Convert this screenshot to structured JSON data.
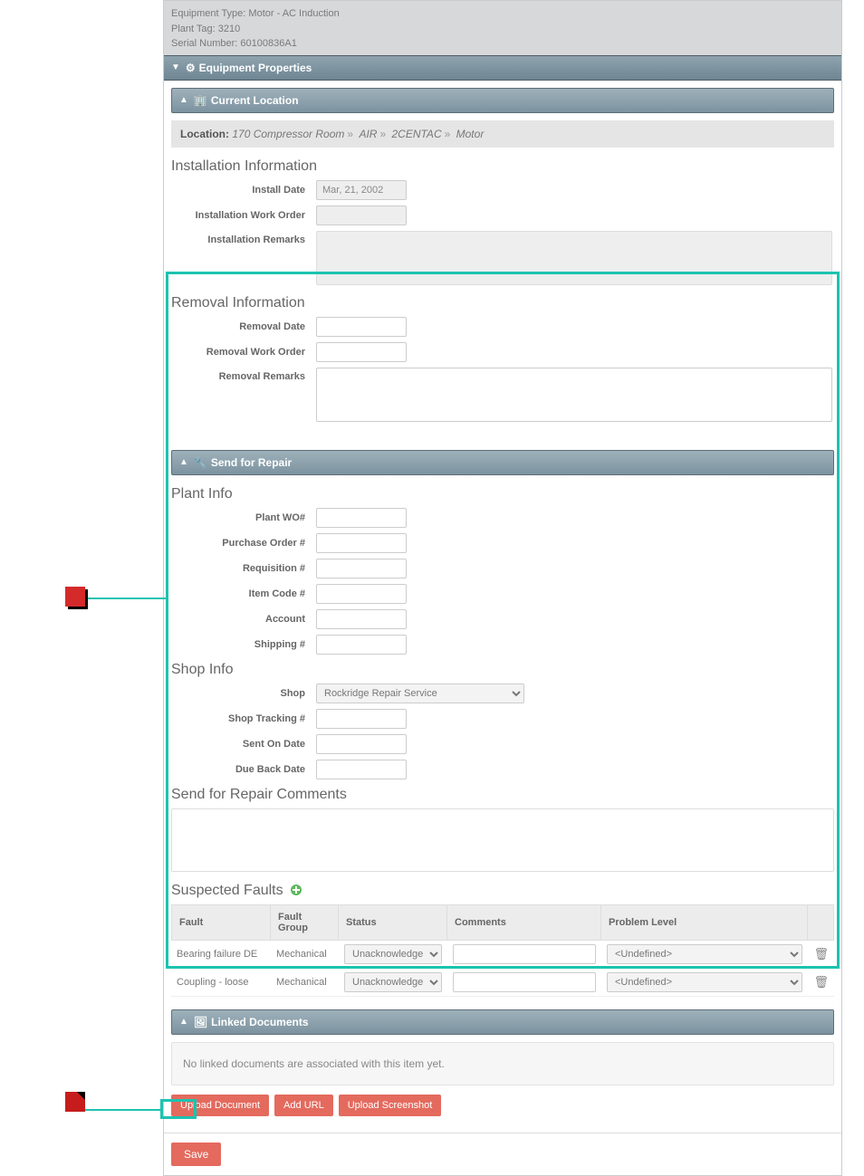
{
  "header": {
    "equip_type_label": "Equipment Type:",
    "equip_type_value": "Motor - AC Induction",
    "plant_tag_label": "Plant Tag:",
    "plant_tag_value": "3210",
    "serial_label": "Serial Number:",
    "serial_value": "60100836A1"
  },
  "panels": {
    "equipment_properties": "Equipment Properties",
    "current_location": "Current Location",
    "send_for_repair": "Send for Repair",
    "linked_documents": "Linked Documents"
  },
  "location": {
    "label": "Location:",
    "crumbs": [
      "170 Compressor Room",
      "AIR",
      "2CENTAC",
      "Motor"
    ]
  },
  "install": {
    "title": "Installation Information",
    "date_label": "Install Date",
    "date_value": "Mar, 21, 2002",
    "wo_label": "Installation Work Order",
    "remarks_label": "Installation Remarks"
  },
  "removal": {
    "title": "Removal Information",
    "date_label": "Removal Date",
    "wo_label": "Removal Work Order",
    "remarks_label": "Removal Remarks"
  },
  "plant_info": {
    "title": "Plant Info",
    "plant_wo": "Plant WO#",
    "po": "Purchase Order #",
    "req": "Requisition #",
    "item": "Item Code #",
    "account": "Account",
    "shipping": "Shipping #"
  },
  "shop_info": {
    "title": "Shop Info",
    "shop": "Shop",
    "shop_value": "Rockridge Repair Service",
    "tracking": "Shop Tracking #",
    "sent": "Sent On Date",
    "due": "Due Back Date"
  },
  "repair_comments": {
    "title": "Send for Repair Comments"
  },
  "faults": {
    "title": "Suspected Faults",
    "headers": {
      "fault": "Fault",
      "group": "Fault Group",
      "status": "Status",
      "comments": "Comments",
      "problem": "Problem Level"
    },
    "rows": [
      {
        "fault": "Bearing failure DE",
        "group": "Mechanical",
        "status": "Unacknowledged",
        "problem": "<Undefined>"
      },
      {
        "fault": "Coupling - loose",
        "group": "Mechanical",
        "status": "Unacknowledged",
        "problem": "<Undefined>"
      }
    ]
  },
  "linked": {
    "empty_msg": "No linked documents are associated with this item yet.",
    "upload_doc": "Upload Document",
    "add_url": "Add URL",
    "upload_ss": "Upload Screenshot"
  },
  "footer": {
    "save": "Save"
  }
}
